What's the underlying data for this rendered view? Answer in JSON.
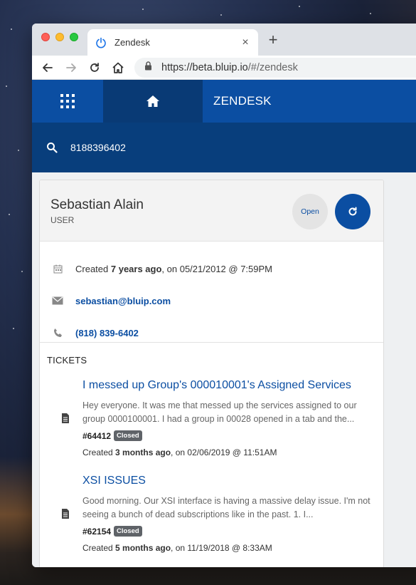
{
  "browser": {
    "tab_title": "Zendesk",
    "tab_close": "×",
    "new_tab": "+",
    "url_scheme": "https://",
    "url_host": "beta.bluip.io",
    "url_path": "/#/zendesk"
  },
  "app": {
    "title": "ZENDESK",
    "accent_color": "#0b4ea2"
  },
  "search": {
    "value": "8188396402"
  },
  "user": {
    "name": "Sebastian Alain",
    "role": "USER",
    "open_label": "Open",
    "created_prefix": "Created ",
    "created_relative": "7 years ago",
    "created_suffix": ", on 05/21/2012 @ 7:59PM",
    "email": "sebastian@bluip.com",
    "phone": "(818) 839-6402"
  },
  "tickets": {
    "title": "TICKETS",
    "items": [
      {
        "subject": "I messed up Group's 000010001's Assigned Services",
        "description": "Hey everyone. It was me that messed up the services assigned to our group 0000100001. I had a group in 00028 opened in a tab and the...",
        "number": "#64412",
        "status": "Closed",
        "created_prefix": "Created ",
        "created_relative": "3 months ago",
        "created_suffix": ", on 02/06/2019 @ 11:51AM"
      },
      {
        "subject": "XSI ISSUES",
        "description": "Good morning. Our XSI interface is having a massive delay issue. I'm not seeing a bunch of dead subscriptions like in the past. 1. I...",
        "number": "#62154",
        "status": "Closed",
        "created_prefix": "Created ",
        "created_relative": "5 months ago",
        "created_suffix": ", on 11/19/2018 @ 8:33AM"
      }
    ]
  }
}
